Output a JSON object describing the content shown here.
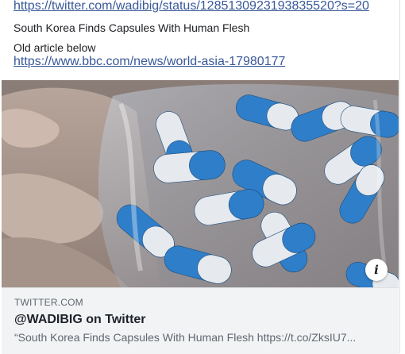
{
  "post": {
    "tweet_link": "https://twitter.com/wadibig/status/1285130923193835520?s=20",
    "headline": "South Korea Finds Capsules With Human Flesh",
    "old_article_label": "Old article below",
    "article_link": "https://www.bbc.com/news/world-asia-17980177"
  },
  "media": {
    "info_icon": "info-icon",
    "info_glyph": "i"
  },
  "link_card": {
    "domain": "TWITTER.COM",
    "title": "@WADIBIG on Twitter",
    "description": "“South Korea Finds Capsules With Human Flesh https://t.co/ZksIU7..."
  },
  "colors": {
    "link": "#385898",
    "card_bg": "#f2f3f5",
    "capsule_blue": "#2f7ec9",
    "capsule_white": "#e6e9ee"
  }
}
